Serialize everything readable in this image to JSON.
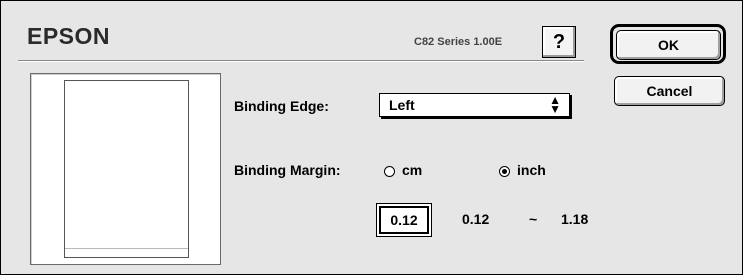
{
  "header": {
    "brand": "EPSON",
    "version": "C82 Series 1.00E",
    "help_label": "?"
  },
  "buttons": {
    "ok_label": "OK",
    "cancel_label": "Cancel"
  },
  "binding_edge": {
    "label": "Binding Edge:",
    "selected": "Left"
  },
  "binding_margin": {
    "label": "Binding Margin:",
    "unit_options": [
      {
        "label": "cm",
        "checked": false
      },
      {
        "label": "inch",
        "checked": true
      }
    ],
    "value": "0.12",
    "range_min": "0.12",
    "range_sep": "~",
    "range_max": "1.18"
  },
  "icons": {
    "select_arrows": "up-down-arrows-icon"
  }
}
